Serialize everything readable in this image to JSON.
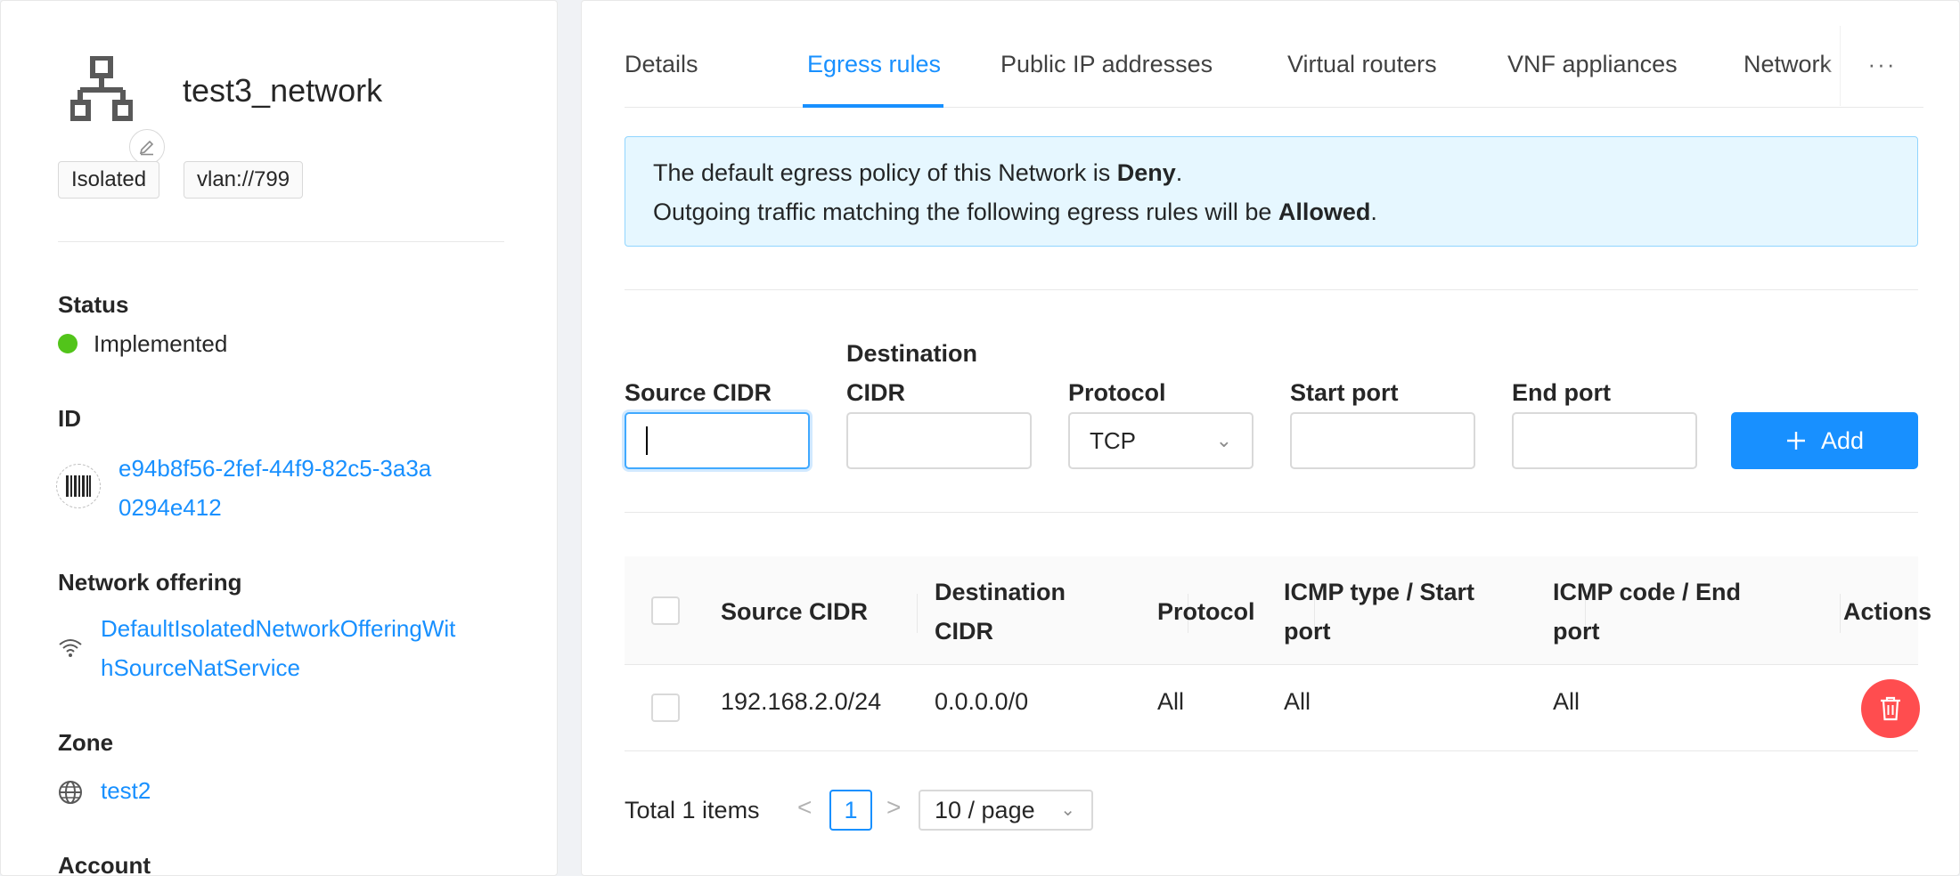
{
  "resource": {
    "name": "test3_network",
    "tags": [
      "Isolated",
      "vlan://799"
    ]
  },
  "details": {
    "status_label": "Status",
    "status_value": "Implemented",
    "id_label": "ID",
    "id_line1": "e94b8f56-2fef-44f9-82c5-3a3a",
    "id_line2": "0294e412",
    "offering_label": "Network offering",
    "offering_line1": "DefaultIsolatedNetworkOfferingWit",
    "offering_line2": "hSourceNatService",
    "zone_label": "Zone",
    "zone_value": "test2",
    "account_label": "Account"
  },
  "tabs": [
    {
      "label": "Details"
    },
    {
      "label": "Egress rules"
    },
    {
      "label": "Public IP addresses"
    },
    {
      "label": "Virtual routers"
    },
    {
      "label": "VNF appliances"
    },
    {
      "label": "Network per"
    }
  ],
  "tabs_more": "···",
  "alert": {
    "line1_pre": "The default egress policy of this Network is ",
    "line1_bold": "Deny",
    "line1_post": ".",
    "line2_pre": "Outgoing traffic matching the following egress rules will be ",
    "line2_bold": "Allowed",
    "line2_post": "."
  },
  "form": {
    "source_cidr_label": "Source CIDR",
    "dest_cidr_label_1": "Destination",
    "dest_cidr_label_2": "CIDR",
    "protocol_label": "Protocol",
    "protocol_value": "TCP",
    "start_port_label": "Start port",
    "end_port_label": "End port",
    "add_label": "Add"
  },
  "table": {
    "headers": {
      "source_cidr": "Source CIDR",
      "dest_cidr_1": "Destination",
      "dest_cidr_2": "CIDR",
      "protocol": "Protocol",
      "icmp_type_1": "ICMP type / Start",
      "icmp_type_2": "port",
      "icmp_code_1": "ICMP code / End",
      "icmp_code_2": "port",
      "actions": "Actions"
    },
    "rows": [
      {
        "source_cidr": "192.168.2.0/24",
        "dest_cidr": "0.0.0.0/0",
        "protocol": "All",
        "icmp_type_start": "All",
        "icmp_code_end": "All"
      }
    ]
  },
  "pagination": {
    "total": "Total 1 items",
    "prev": "<",
    "current": "1",
    "next": ">",
    "page_size": "10 / page"
  },
  "colors": {
    "accent": "#1890ff",
    "status_ok": "#52c41a",
    "danger": "#ff4d4f",
    "alert_bg": "#e6f7ff"
  },
  "icons": {
    "network": "network-tree-icon",
    "edit": "pencil-icon",
    "id": "barcode-icon",
    "offering": "wifi-icon",
    "zone": "globe-icon",
    "add": "plus-icon",
    "delete": "trash-icon"
  }
}
